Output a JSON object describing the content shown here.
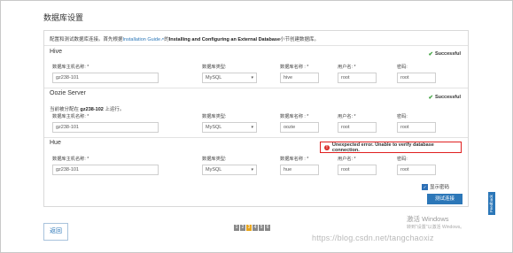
{
  "page": {
    "title": "数据库设置"
  },
  "intro": {
    "prefix": "配置和测试数据库连接。首先根据",
    "link": "Installation Guide",
    "middle": "的",
    "bold": "Installing and Configuring an External Database",
    "suffix": "小节创建数据库。"
  },
  "labels": {
    "host": "数据库主机名称: *",
    "type": "数据库类型:",
    "name": "数据库名称 : *",
    "user": "用户名: *",
    "password": "密码:"
  },
  "sections": [
    {
      "title": "Hive",
      "status": "Successful",
      "host": "gz238-101",
      "type": "MySQL",
      "db": "hive",
      "user": "root",
      "password": "root"
    },
    {
      "title": "Oozie Server",
      "status": "Successful",
      "note_prefix": "当前被分配在",
      "note_host": "gz238-102",
      "note_suffix": "上运行。",
      "host": "gz238-101",
      "type": "MySQL",
      "db": "oozie",
      "user": "root",
      "password": "root"
    },
    {
      "title": "Hue",
      "error": "Unexpected error. Unable to verify database connection.",
      "host": "gz238-101",
      "type": "MySQL",
      "db": "hue",
      "user": "root",
      "password": "root"
    }
  ],
  "footer": {
    "show_password": "显示密码",
    "test_button": "测试连接",
    "back_button": "返回",
    "steps": [
      "1",
      "2",
      "3",
      "4",
      "5",
      "6"
    ],
    "active_step": 3,
    "feedback": "Feedback"
  },
  "overlay": {
    "windows_activate": "激活 Windows",
    "windows_sub": "转到\"设置\"以激活 Windows。",
    "watermark": "https://blog.csdn.net/tangchaoxiz"
  },
  "colors": {
    "accent": "#2c77b8",
    "success": "#3ca03c",
    "error_border": "#e02020",
    "active_step": "#e8a51c"
  }
}
